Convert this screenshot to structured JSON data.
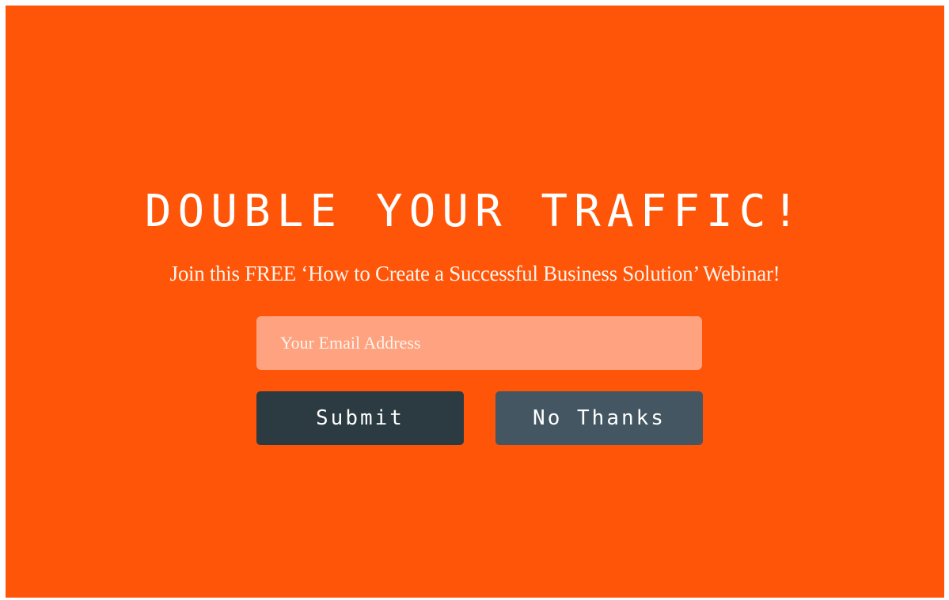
{
  "popup": {
    "headline": "DOUBLE YOUR TRAFFIC!",
    "subline": "Join this FREE  ‘How to Create a Successful Business Solution’ Webinar!",
    "email_placeholder": "Your Email Address",
    "submit_label": "Submit",
    "decline_label": "No Thanks"
  },
  "colors": {
    "background": "#fe5509",
    "field": "#fea27f",
    "submit_button": "#2c3a41",
    "decline_button": "#435661",
    "text": "#ffffff"
  }
}
